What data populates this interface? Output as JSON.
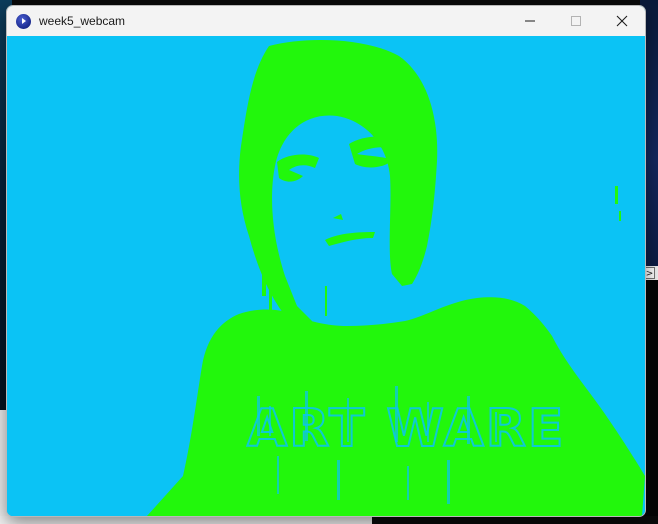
{
  "desktop": {
    "side_button_label": ">"
  },
  "window": {
    "title": "week5_webcam",
    "app_icon": "processing-app-icon",
    "controls": [
      {
        "name": "minimize-button",
        "icon": "minimize-icon"
      },
      {
        "name": "maximize-button",
        "icon": "maximize-icon",
        "disabled": true
      },
      {
        "name": "close-button",
        "icon": "close-icon"
      }
    ]
  },
  "canvas": {
    "description_colors": {
      "background": "#0bc3f5",
      "foreground": "#22f70c"
    },
    "shirt_text": "ART WARE"
  }
}
